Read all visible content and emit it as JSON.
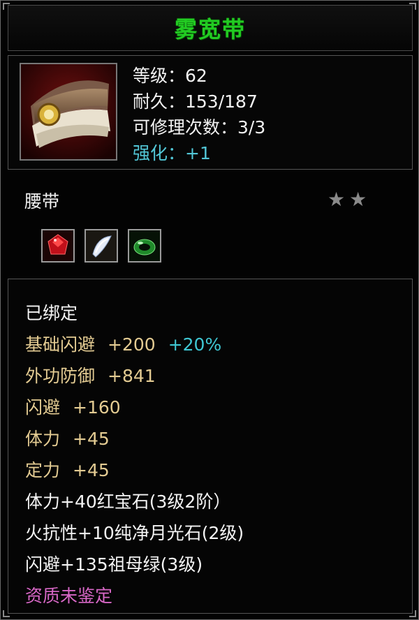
{
  "title": "雾宽带",
  "stats": {
    "level": "等级：62",
    "durability": "耐久：153/187",
    "repair": "可修理次数：3/3",
    "enhance": "强化：+1"
  },
  "item_type": "腰带",
  "stars": "★★",
  "gems": [
    "ruby-icon",
    "moonstone-icon",
    "emerald-icon"
  ],
  "attributes": {
    "bound": "已绑定",
    "base_dodge": {
      "label": "基础闪避",
      "value": "+200",
      "bonus": "+20%"
    },
    "outer_defense": {
      "label": "外功防御",
      "value": "+841"
    },
    "dodge": {
      "label": "闪避",
      "value": "+160"
    },
    "stamina": {
      "label": "体力",
      "value": "+45"
    },
    "focus": {
      "label": "定力",
      "value": "+45"
    },
    "gem1": "体力+40红宝石(3级2阶）",
    "gem2": "火抗性+10纯净月光石(2级)",
    "gem3": "闪避+135祖母绿(3级)",
    "quality": "资质未鉴定"
  },
  "colors": {
    "title": "#22cc22",
    "gold": "#e3cb92",
    "cyan": "#3fc7d3",
    "pink": "#d767c6"
  }
}
